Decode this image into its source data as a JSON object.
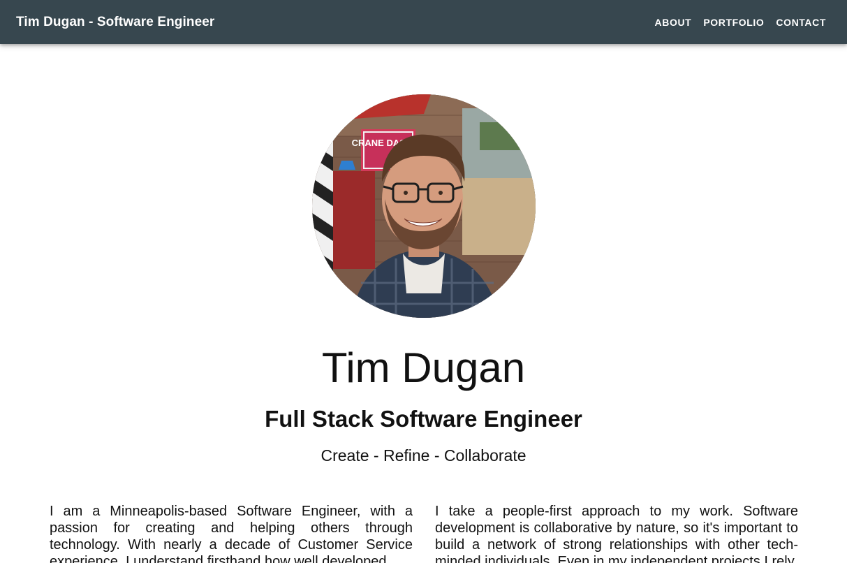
{
  "header": {
    "brand": "Tim Dugan - Software Engineer",
    "nav": [
      "ABOUT",
      "PORTFOLIO",
      "CONTACT"
    ]
  },
  "profile": {
    "photo_alt": "Portrait of Tim Dugan",
    "photo_sign_text": "CRANE DASHER",
    "name": "Tim Dugan",
    "title": "Full Stack Software Engineer",
    "tagline": "Create - Refine - Collaborate"
  },
  "about": {
    "paragraph_left": "I am a Minneapolis-based Software Engineer, with a passion for creating and helping others through technology. With nearly a decade of Customer Service experience, I understand firsthand how well developed",
    "paragraph_right": "I take a people-first approach to my work. Software development is collaborative by nature, so it's important to build a network of strong relationships with other tech-minded individuals. Even in my independent projects I rely"
  },
  "colors": {
    "appbar": "#37474f",
    "text": "#111111"
  }
}
